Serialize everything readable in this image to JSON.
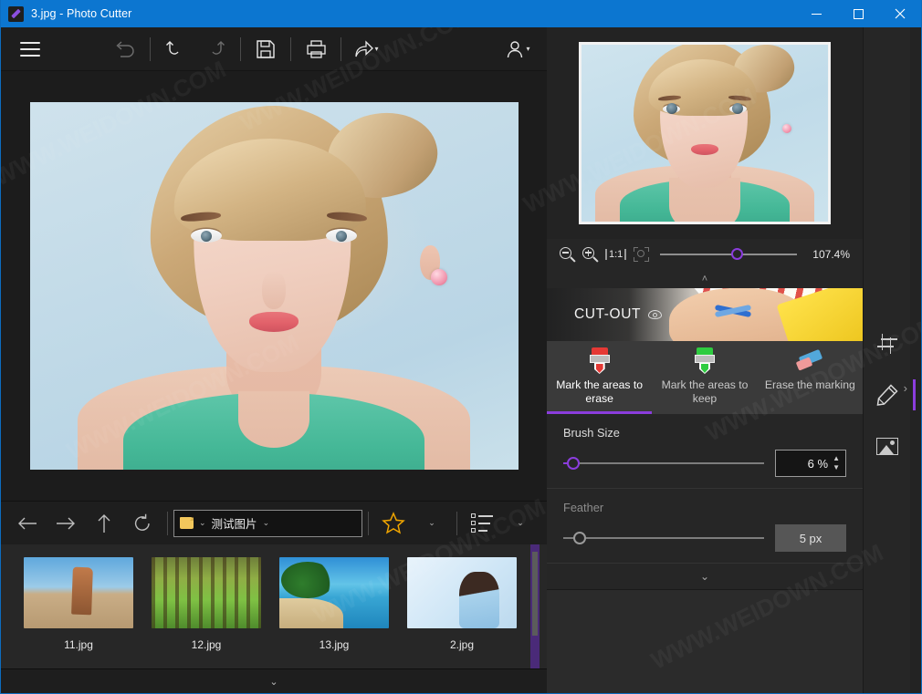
{
  "window": {
    "title": "3.jpg - Photo Cutter",
    "app_icon": "pencil-icon",
    "minimize_label": "–",
    "maximize_label": "☐",
    "close_label": "✕",
    "titlebar_color": "#0c76d0"
  },
  "toolbar": {
    "menu_label": "menu",
    "items": [
      {
        "name": "revert",
        "icon": "revert-icon",
        "disabled": true
      },
      {
        "name": "undo",
        "icon": "undo-icon",
        "disabled": false
      },
      {
        "name": "redo",
        "icon": "redo-icon",
        "disabled": true
      },
      {
        "name": "save",
        "icon": "save-icon",
        "disabled": false
      },
      {
        "name": "print",
        "icon": "print-icon",
        "disabled": false
      },
      {
        "name": "share",
        "icon": "share-icon",
        "disabled": false
      },
      {
        "name": "account",
        "icon": "account-icon",
        "disabled": false
      }
    ],
    "caret": "▾"
  },
  "navbar": {
    "back": "←",
    "forward": "→",
    "up": "↑",
    "refresh": "↻",
    "path": {
      "folder_icon": "folder-icon",
      "name": "测试图片",
      "chevron": "⌄"
    },
    "favorites_icon": "star-icon",
    "favorites_caret": "⌄",
    "sort_icon": "sort-list-icon",
    "sort_caret": "⌄"
  },
  "thumbnails": [
    {
      "label": "11.jpg",
      "style": "t-rock"
    },
    {
      "label": "12.jpg",
      "style": "t-forest"
    },
    {
      "label": "13.jpg",
      "style": "t-beach"
    },
    {
      "label": "2.jpg",
      "style": "t-girl"
    }
  ],
  "bottom_collapse": "⌄",
  "preview": {
    "zoom_value": "107.4%",
    "zoom_out_icon": "zoom-out-icon",
    "zoom_in_icon": "zoom-in-icon",
    "actual_size_label": "1:1",
    "fit_icon": "fit-to-window-icon",
    "collapse_chevron": "˄"
  },
  "cutout": {
    "title": "CUT-OUT",
    "help_icon": "eye-icon",
    "tabs": [
      {
        "label": "Mark the areas to erase",
        "icon": "red-marker-icon",
        "active": true,
        "color": "#e53935"
      },
      {
        "label": "Mark the areas to keep",
        "icon": "green-marker-icon",
        "active": false,
        "color": "#2ecc40"
      },
      {
        "label": "Erase the marking",
        "icon": "eraser-icon",
        "active": false,
        "color": "#52a8db"
      }
    ],
    "controls": [
      {
        "label": "Brush Size",
        "value": "6 %",
        "enabled": true,
        "knob_percent": 5,
        "type": "spinner"
      },
      {
        "label": "Feather",
        "value": "5 px",
        "enabled": false,
        "knob_percent": 10,
        "type": "readonly"
      }
    ],
    "panel_chevron": "⌄"
  },
  "rail": {
    "items": [
      {
        "name": "crop-tool",
        "icon": "crop-icon",
        "active": false
      },
      {
        "name": "edit-tool",
        "icon": "pencil-icon",
        "active": true
      },
      {
        "name": "image-tool",
        "icon": "image-icon",
        "active": false
      }
    ],
    "expand_chevron": "›"
  },
  "accent_color": "#8b3ddd",
  "watermark_text": "WWW.WEIDOWN.COM"
}
